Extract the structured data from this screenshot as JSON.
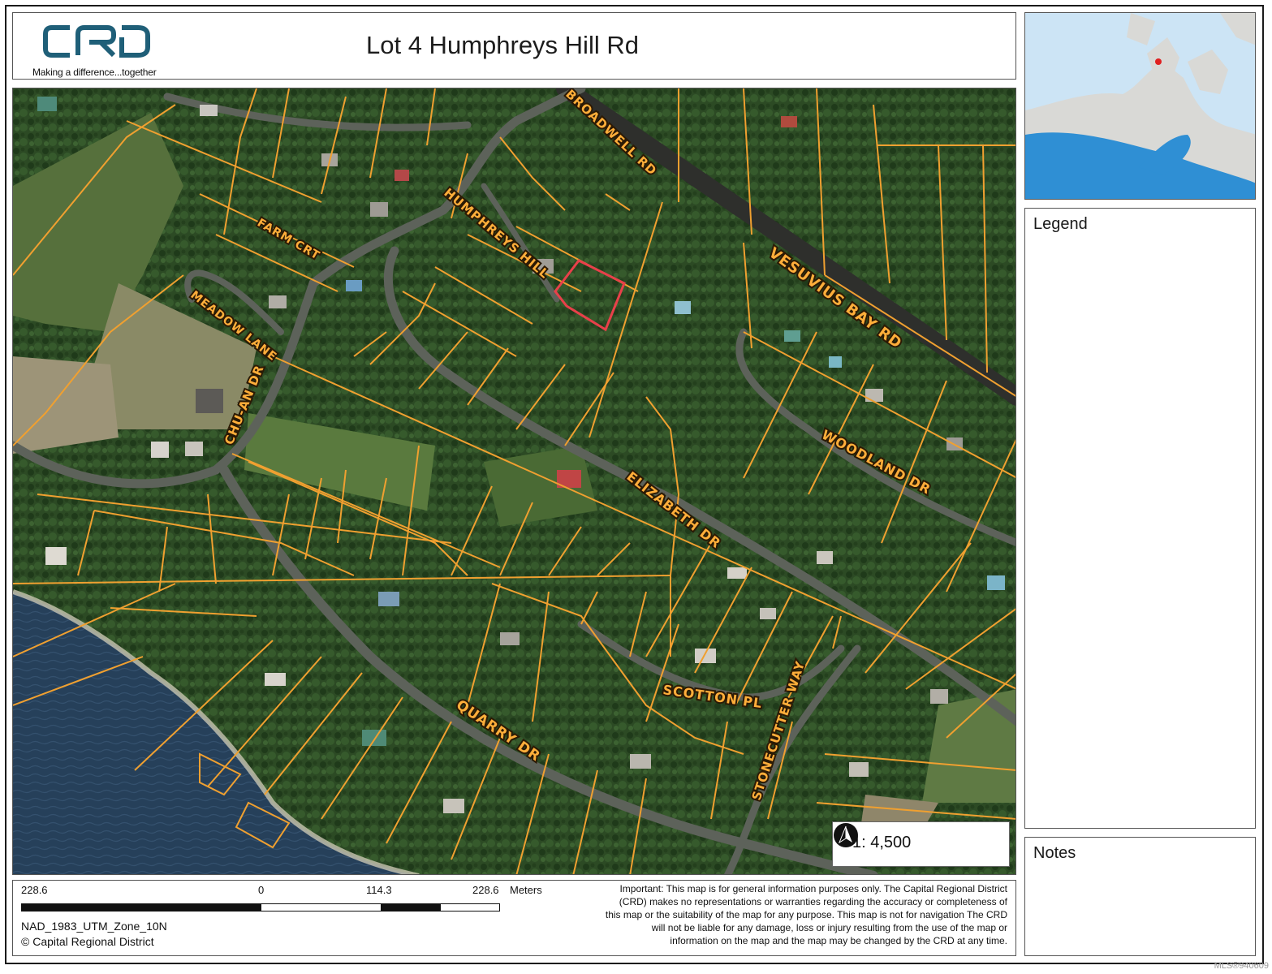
{
  "header": {
    "logo_text": "CRD",
    "logo_tagline": "Making a difference...together",
    "title": "Lot 4 Humphreys Hill Rd"
  },
  "map": {
    "scale_text": "1: 4,500",
    "north_arrow_icon": "north-arrow-icon",
    "road_labels": {
      "broadwell": "BROADWELL RD",
      "humphreys": "HUMPHREYS HILL",
      "farm": "FARM CRT",
      "meadow": "MEADOW LANE",
      "vesuvius": "VESUVIUS BAY RD",
      "chuan": "CHU-AN DR",
      "woodland": "WOODLAND DR",
      "elizabeth": "ELIZABETH DR",
      "scotton": "SCOTTON PL",
      "stonecutter": "STONECUTTER WAY",
      "quarry": "QUARRY DR"
    },
    "colors": {
      "parcel_line": "#f0a030",
      "subject_lot": "#e8404a",
      "forest": "#2a4522",
      "water": "#233a52",
      "road": "#5a5f58"
    }
  },
  "sidebar": {
    "legend_title": "Legend",
    "notes_title": "Notes"
  },
  "footer": {
    "scalebar": {
      "label_left": "228.6",
      "label_zero": "0",
      "label_mid": "114.3",
      "label_right": "228.6",
      "unit": "Meters"
    },
    "projection": "NAD_1983_UTM_Zone_10N",
    "copyright": "© Capital Regional District",
    "disclaimer": "Important: This map is for general information purposes only. The Capital Regional District (CRD) makes no representations or warranties regarding the accuracy or completeness of this map or the suitability of the map for any purpose. This map is not for navigation  The CRD will not be liable for any damage, loss or injury resulting from the use of the map or information on the map and the map may be changed by the CRD at any time."
  },
  "watermark": "MLS®940609"
}
